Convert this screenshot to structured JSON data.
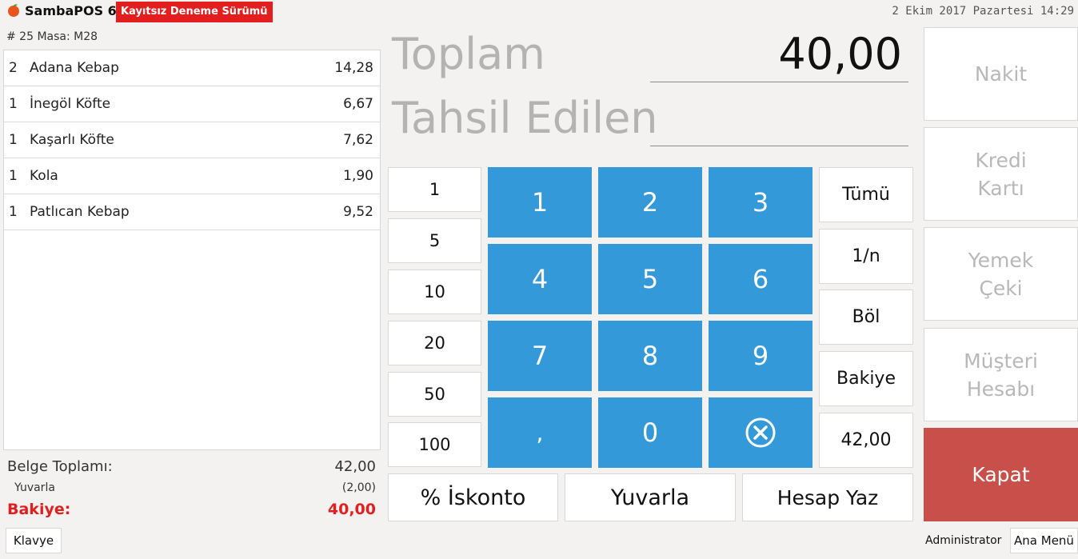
{
  "header": {
    "app_title": "SambaPOS 6",
    "trial_badge": "Kayıtsız Deneme Sürümü",
    "datetime": "2 Ekim 2017 Pazartesi 14:29",
    "ticket_info": "# 25 Masa: M28"
  },
  "orders": [
    {
      "qty": "2",
      "name": "Adana Kebap",
      "price": "14,28"
    },
    {
      "qty": "1",
      "name": "İnegöl Köfte",
      "price": "6,67"
    },
    {
      "qty": "1",
      "name": "Kaşarlı Köfte",
      "price": "7,62"
    },
    {
      "qty": "1",
      "name": "Kola",
      "price": "1,90"
    },
    {
      "qty": "1",
      "name": "Patlıcan Kebap",
      "price": "9,52"
    }
  ],
  "summary": {
    "document_total_label": "Belge Toplamı:",
    "document_total_value": "42,00",
    "rounding_label": "Yuvarla",
    "rounding_value": "(2,00)",
    "balance_label": "Bakiye:",
    "balance_value": "40,00"
  },
  "keyboard_button": "Klavye",
  "payment": {
    "total_label": "Toplam",
    "total_value": "40,00",
    "collected_label": "Tahsil Edilen",
    "collected_value": ""
  },
  "quick_amounts": [
    "1",
    "5",
    "10",
    "20",
    "50",
    "100"
  ],
  "numpad": {
    "k1": "1",
    "k2": "2",
    "k3": "3",
    "k4": "4",
    "k5": "5",
    "k6": "6",
    "k7": "7",
    "k8": "8",
    "k9": "9",
    "comma": ",",
    "k0": "0"
  },
  "numpad_icons": {
    "clear": "clear-circle-x-icon"
  },
  "side_buttons": {
    "all": "Tümü",
    "fraction": "1/n",
    "split": "Böl",
    "balance": "Bakiye",
    "amount": "42,00"
  },
  "bottom_buttons": {
    "discount": "% İskonto",
    "round": "Yuvarla",
    "print": "Hesap Yaz"
  },
  "payment_types": {
    "cash": "Nakit",
    "credit_card_line1": "Kredi",
    "credit_card_line2": "Kartı",
    "meal_voucher_line1": "Yemek",
    "meal_voucher_line2": "Çeki",
    "customer_account_line1": "Müşteri",
    "customer_account_line2": "Hesabı"
  },
  "close_button": "Kapat",
  "footer": {
    "user": "Administrator",
    "main_menu": "Ana Menü"
  },
  "colors": {
    "numpad_blue": "#3399d9",
    "close_red": "#c9504a",
    "badge_red": "#e21e1e",
    "balance_red": "#e21e1e"
  }
}
